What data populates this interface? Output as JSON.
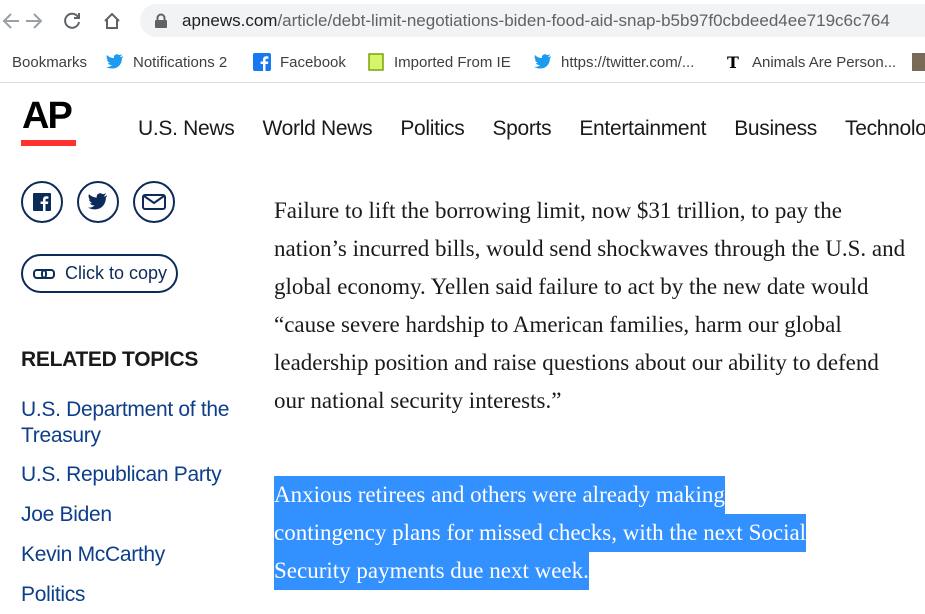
{
  "browser": {
    "url_domain": "apnews.com",
    "url_path": "/article/debt-limit-negotiations-biden-food-aid-snap-b5b97f0cbdeed4ee719c6c764",
    "bookmarks": [
      {
        "label": "Bookmarks",
        "icon": "bookmarks-folder-icon"
      },
      {
        "label": "Notifications 2",
        "icon": "twitter-icon"
      },
      {
        "label": "Facebook",
        "icon": "facebook-icon"
      },
      {
        "label": "Imported From IE",
        "icon": "folder-icon"
      },
      {
        "label": "https://twitter.com/...",
        "icon": "twitter-icon"
      },
      {
        "label": "Animals Are Person...",
        "icon": "nyt-icon"
      }
    ]
  },
  "site": {
    "logo": "AP",
    "nav": [
      "U.S. News",
      "World News",
      "Politics",
      "Sports",
      "Entertainment",
      "Business",
      "Technolog"
    ]
  },
  "sidebar": {
    "copy_label": "Click to copy",
    "related_title": "RELATED TOPICS",
    "topics": [
      "U.S. Department of the Treasury",
      "U.S. Republican Party",
      "Joe Biden",
      "Kevin McCarthy",
      "Politics"
    ]
  },
  "article": {
    "paragraph1": "Failure to lift the borrowing limit, now $31 trillion, to pay the nation’s incurred bills, would send shockwaves through the U.S. and global economy. Yellen said failure to act by the new date would “cause severe hardship to American families, harm our global leadership position and raise questions about our ability to defend our national security interests.”",
    "highlighted_lines": [
      "Anxious retirees and others were already making",
      "contingency plans for missed checks, with the next Social",
      "Security payments due next week."
    ]
  },
  "colors": {
    "ap_red": "#ff322e",
    "link_blue": "#0d3e8a",
    "selection": "#3390ff"
  }
}
